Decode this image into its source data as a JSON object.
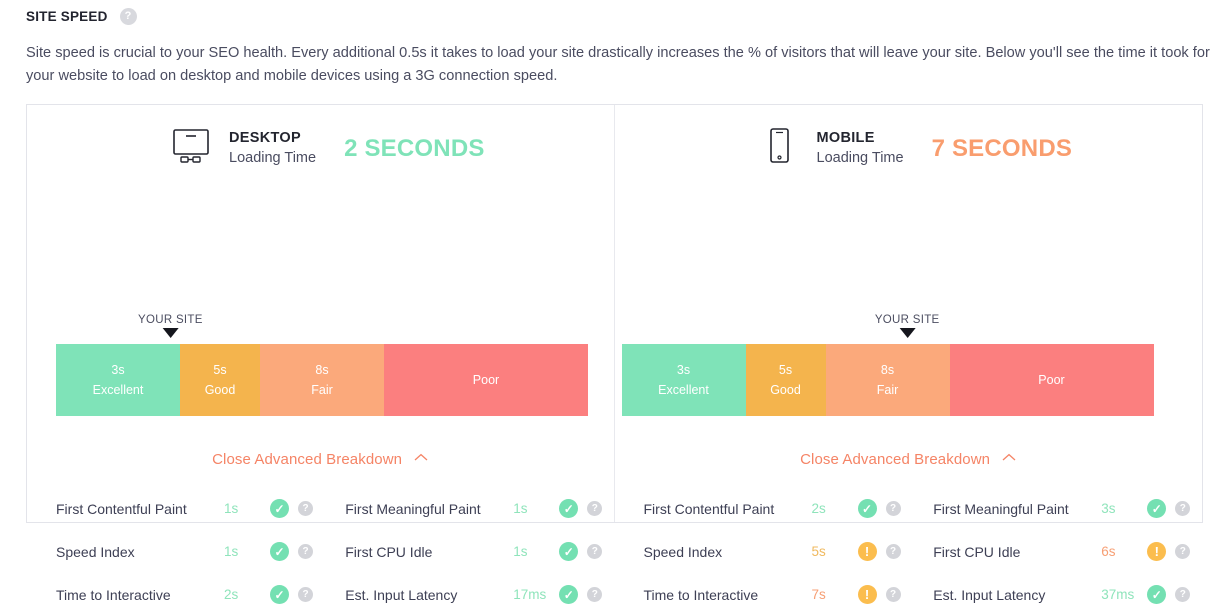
{
  "section": {
    "title": "SITE SPEED",
    "help_icon": "help-icon",
    "description": "Site speed is crucial to your SEO health. Every additional 0.5s it takes to load your site drastically increases the % of visitors that will leave your site. Below you'll see the time it took for your website to load on desktop and mobile devices using a 3G connection speed."
  },
  "colors": {
    "excellent": "#7fe3b8",
    "good": "#f4b council",
    "good_hex": "#f4b44d",
    "fair": "#fba97b",
    "poor": "#fb7f7f",
    "pass": "#74e0b2",
    "warn": "#fbbd4e",
    "accent_orange": "#f58466",
    "green_text": "#7fe3b8"
  },
  "scale_segments": [
    {
      "time": "3s",
      "label": "Excellent"
    },
    {
      "time": "5s",
      "label": "Good"
    },
    {
      "time": "8s",
      "label": "Fair"
    },
    {
      "time": "",
      "label": "Poor"
    }
  ],
  "panels": [
    {
      "device": "DESKTOP",
      "device_icon": "desktop-monitor-icon",
      "subtitle": "Loading Time",
      "loading_time": "2 SECONDS",
      "loading_time_color": "#7fe3b8",
      "marker_label": "YOUR SITE",
      "marker_position_pct": 21.5,
      "breakdown_label": "Close Advanced Breakdown",
      "breakdown_chevron": "chevron-up-icon",
      "metrics_left": [
        {
          "name": "First Contentful Paint",
          "value": "1s",
          "value_color": "#8fe4bb",
          "status": "pass",
          "status_icon": "check-circle-icon"
        },
        {
          "name": "Speed Index",
          "value": "1s",
          "value_color": "#8fe4bb",
          "status": "pass",
          "status_icon": "check-circle-icon"
        },
        {
          "name": "Time to Interactive",
          "value": "2s",
          "value_color": "#8fe4bb",
          "status": "pass",
          "status_icon": "check-circle-icon"
        }
      ],
      "metrics_right": [
        {
          "name": "First Meaningful Paint",
          "value": "1s",
          "value_color": "#8fe4bb",
          "status": "pass",
          "status_icon": "check-circle-icon"
        },
        {
          "name": "First CPU Idle",
          "value": "1s",
          "value_color": "#8fe4bb",
          "status": "pass",
          "status_icon": "check-circle-icon"
        },
        {
          "name": "Est. Input Latency",
          "value": "17ms",
          "value_color": "#8fe4bb",
          "status": "pass",
          "status_icon": "check-circle-icon"
        }
      ]
    },
    {
      "device": "MOBILE",
      "device_icon": "mobile-phone-icon",
      "subtitle": "Loading Time",
      "loading_time": "7 SECONDS",
      "loading_time_color": "#f99d6e",
      "marker_label": "YOUR SITE",
      "marker_position_pct": 53.7,
      "breakdown_label": "Close Advanced Breakdown",
      "breakdown_chevron": "chevron-up-icon",
      "metrics_left": [
        {
          "name": "First Contentful Paint",
          "value": "2s",
          "value_color": "#8fe4bb",
          "status": "pass",
          "status_icon": "check-circle-icon"
        },
        {
          "name": "Speed Index",
          "value": "5s",
          "value_color": "#f0b95e",
          "status": "warn",
          "status_icon": "exclamation-circle-icon"
        },
        {
          "name": "Time to Interactive",
          "value": "7s",
          "value_color": "#f79f74",
          "status": "warn",
          "status_icon": "exclamation-circle-icon"
        }
      ],
      "metrics_right": [
        {
          "name": "First Meaningful Paint",
          "value": "3s",
          "value_color": "#8fe4bb",
          "status": "pass",
          "status_icon": "check-circle-icon"
        },
        {
          "name": "First CPU Idle",
          "value": "6s",
          "value_color": "#f79f74",
          "status": "warn",
          "status_icon": "exclamation-circle-icon"
        },
        {
          "name": "Est. Input Latency",
          "value": "37ms",
          "value_color": "#8fe4bb",
          "status": "pass",
          "status_icon": "check-circle-icon"
        }
      ]
    }
  ]
}
